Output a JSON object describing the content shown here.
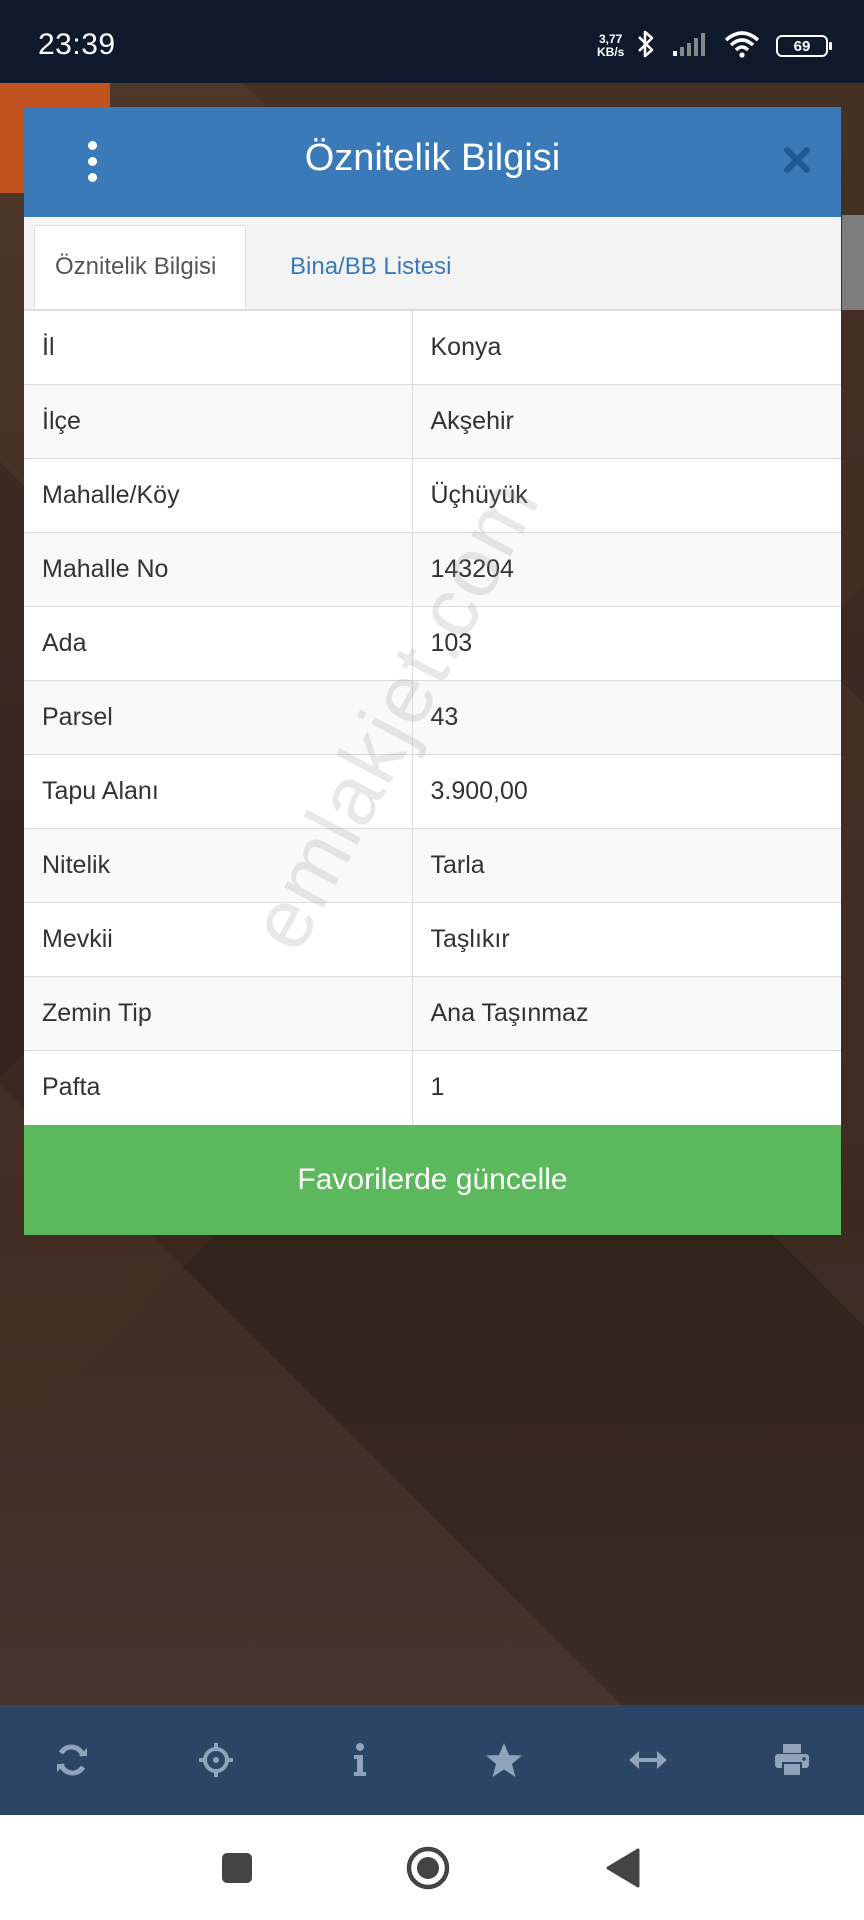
{
  "status_bar": {
    "time": "23:39",
    "net_speed_value": "3,77",
    "net_speed_unit": "KB/s",
    "battery": "69"
  },
  "modal": {
    "title": "Öznitelik Bilgisi",
    "tabs": [
      {
        "label": "Öznitelik Bilgisi",
        "active": true
      },
      {
        "label": "Bina/BB Listesi",
        "active": false
      }
    ],
    "rows": [
      {
        "key": "İl",
        "value": "Konya"
      },
      {
        "key": "İlçe",
        "value": "Akşehir"
      },
      {
        "key": "Mahalle/Köy",
        "value": "Üçhüyük"
      },
      {
        "key": "Mahalle No",
        "value": "143204"
      },
      {
        "key": "Ada",
        "value": "103"
      },
      {
        "key": "Parsel",
        "value": "43"
      },
      {
        "key": "Tapu Alanı",
        "value": "3.900,00"
      },
      {
        "key": "Nitelik",
        "value": "Tarla"
      },
      {
        "key": "Mevkii",
        "value": "Taşlıkır"
      },
      {
        "key": "Zemin Tip",
        "value": "Ana Taşınmaz"
      },
      {
        "key": "Pafta",
        "value": "1"
      }
    ],
    "update_button": "Favorilerde güncelle"
  },
  "watermark": "emlakjet.com",
  "toolbar": {
    "icons": [
      "refresh-icon",
      "locate-crosshair-icon",
      "info-icon",
      "star-icon",
      "measure-arrows-icon",
      "print-icon"
    ]
  },
  "colors": {
    "header_blue": "#3a7ab8",
    "button_green": "#5cb85c",
    "toolbar_bg": "#2a4565",
    "status_bg": "#0e1a2b"
  }
}
